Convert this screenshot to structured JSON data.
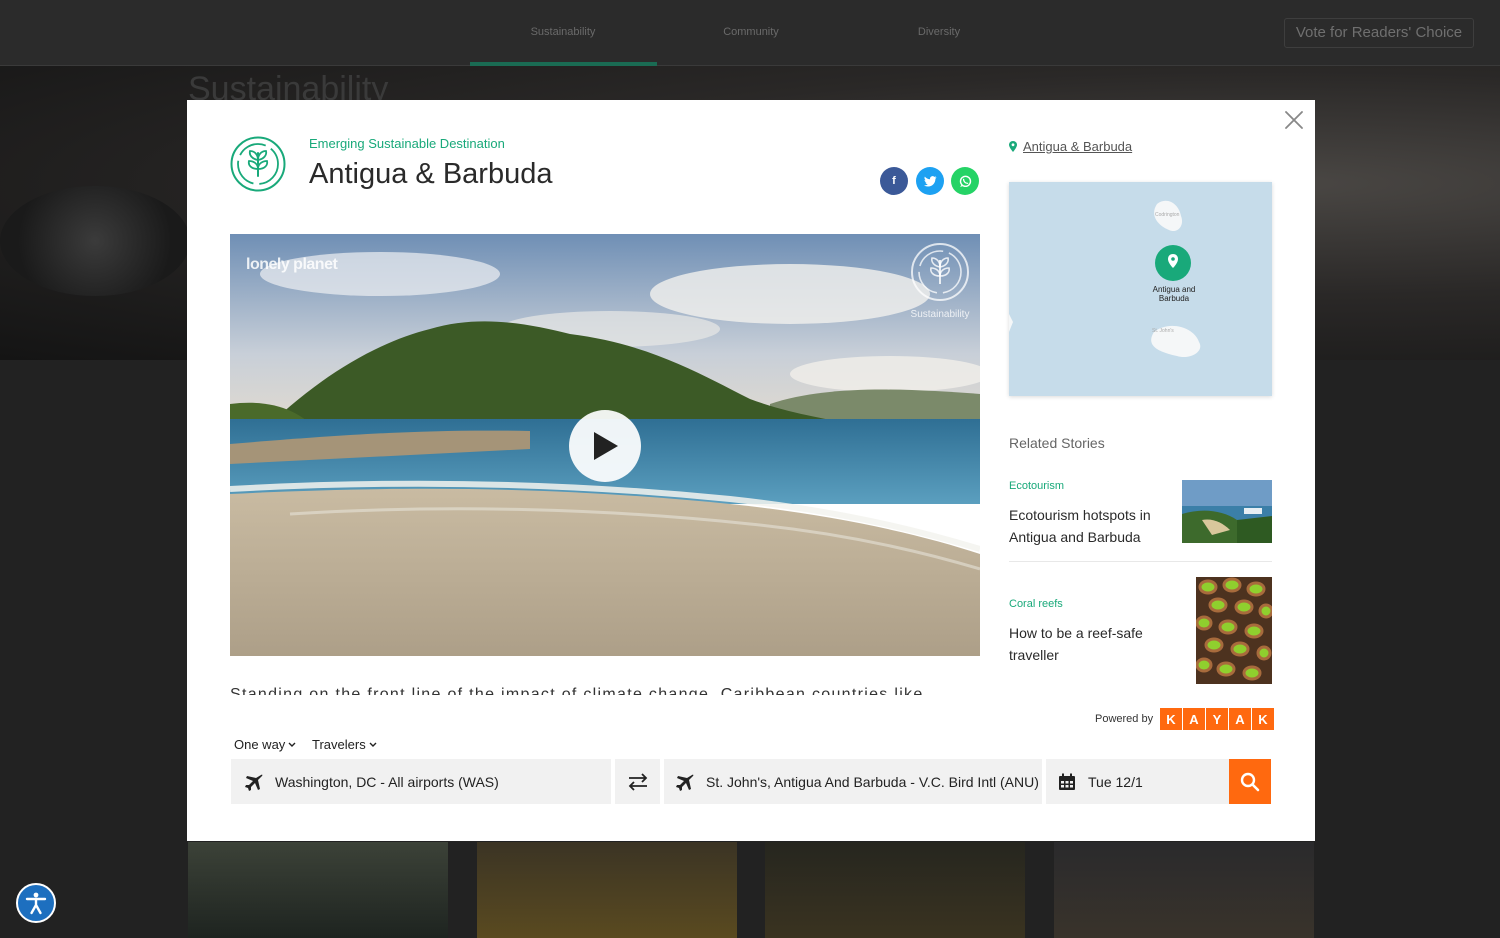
{
  "topnav": {
    "items": [
      "Sustainability",
      "Community",
      "Diversity"
    ],
    "vote_label": "Vote for Readers' Choice"
  },
  "hero": {
    "title": "Sustainability"
  },
  "modal": {
    "eyebrow": "Emerging Sustainable Destination",
    "title": "Antigua & Barbuda",
    "share": {
      "facebook": "f"
    },
    "video": {
      "brand": "lonely planet",
      "watermark": "Sustainability"
    },
    "description_peek": "Standing on the front line of the impact of climate change, Caribbean countries like",
    "location_link": "Antigua & Barbuda",
    "map": {
      "marker_label_line1": "Antigua and",
      "marker_label_line2": "Barbuda",
      "town_north": "Codrington",
      "town_south": "St. John's"
    },
    "related": {
      "title": "Related Stories",
      "stories": [
        {
          "category": "Ecotourism",
          "headline": "Ecotourism hotspots in Antigua and Barbuda"
        },
        {
          "category": "Coral reefs",
          "headline": "How to be a reef-safe traveller"
        }
      ]
    },
    "kayak": {
      "powered_by": "Powered by",
      "letters": [
        "K",
        "A",
        "Y",
        "A",
        "K"
      ],
      "brand_color": "#ff690f"
    },
    "flight": {
      "trip_type": "One way",
      "travelers": "Travelers",
      "origin": "Washington, DC - All airports (WAS)",
      "destination": "St. John's, Antigua And Barbuda - V.C. Bird Intl (ANU)",
      "date": "Tue 12/1"
    }
  },
  "colors": {
    "accent_green": "#19a97a",
    "accessibility_blue": "#1d6fbf"
  }
}
